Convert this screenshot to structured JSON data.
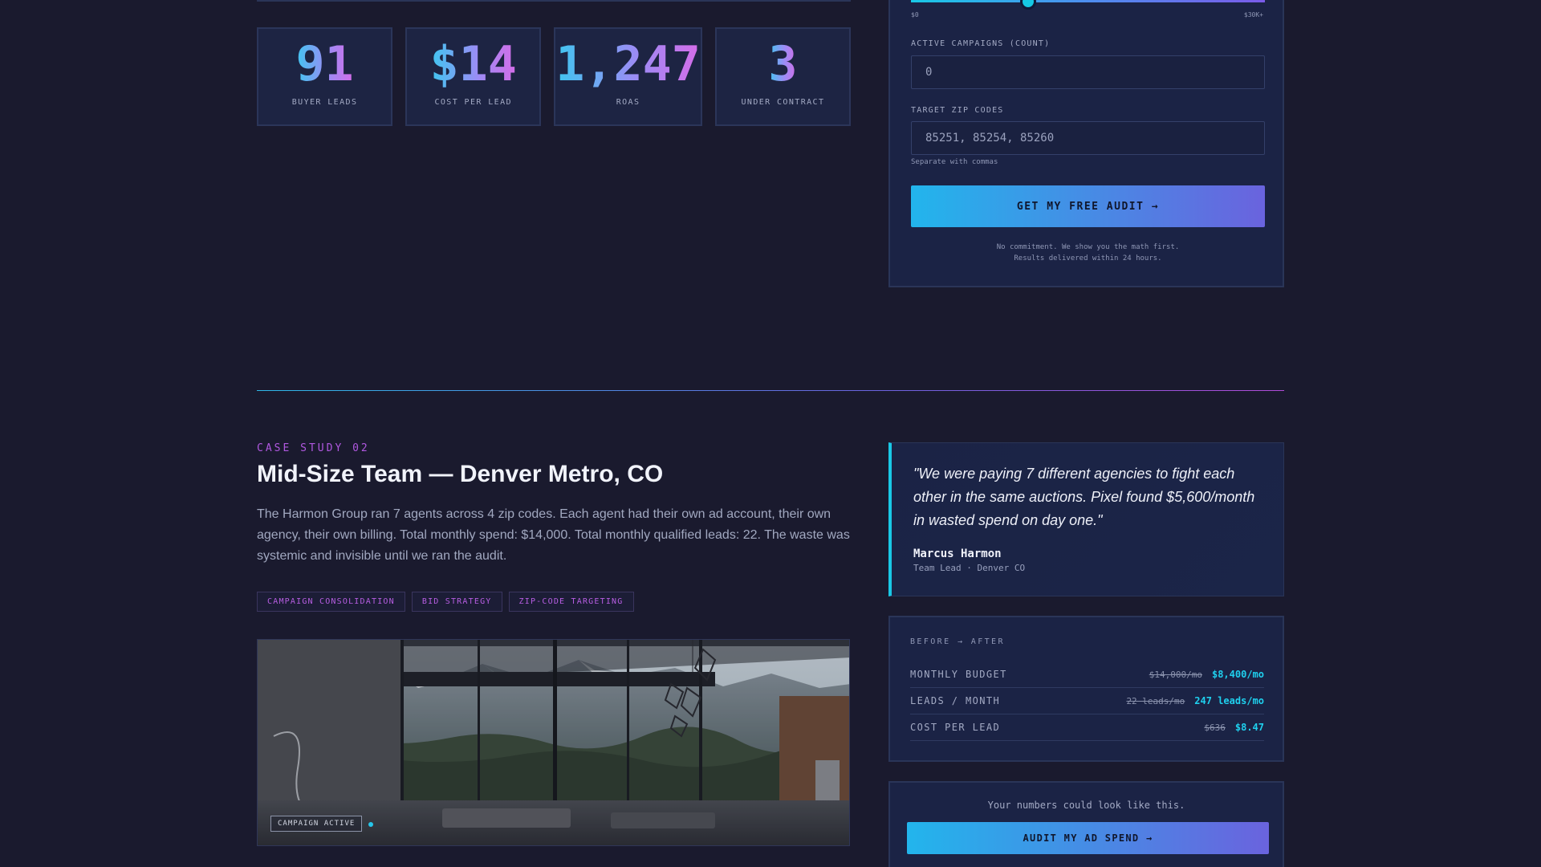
{
  "stats": [
    {
      "value": "91",
      "label": "BUYER LEADS"
    },
    {
      "value": "$14",
      "label": "COST PER LEAD"
    },
    {
      "value": "1,247",
      "label": "ROAS"
    },
    {
      "value": "3",
      "label": "UNDER CONTRACT"
    }
  ],
  "form": {
    "slider": {
      "min_label": "$0",
      "max_label": "$30K+",
      "value_fraction": 0.33
    },
    "campaigns_label": "ACTIVE CAMPAIGNS (COUNT)",
    "campaigns_placeholder": "0",
    "zip_label": "TARGET ZIP CODES",
    "zip_placeholder": "85251, 85254, 85260",
    "zip_hint": "Separate with commas",
    "submit_label": "GET MY FREE AUDIT →",
    "note_line1": "No commitment. We show you the math first.",
    "note_line2": "Results delivered within 24 hours."
  },
  "case_study": {
    "eyebrow": "CASE STUDY 02",
    "title": "Mid-Size Team — Denver Metro, CO",
    "body": "The Harmon Group ran 7 agents across 4 zip codes. Each agent had their own ad account, their own agency, their own billing. Total monthly spend: $14,000. Total monthly qualified leads: 22. The waste was systemic and invisible until we ran the audit.",
    "tags": [
      "CAMPAIGN CONSOLIDATION",
      "BID STRATEGY",
      "ZIP-CODE TARGETING"
    ],
    "image_badge": "CAMPAIGN ACTIVE"
  },
  "testimonial": {
    "quote": "\"We were paying 7 different agencies to fight each other in the same auctions. Pixel found $5,600/month in wasted spend on day one.\"",
    "name": "Marcus Harmon",
    "role": "Team Lead · Denver CO"
  },
  "before_after": {
    "heading": "BEFORE → AFTER",
    "rows": [
      {
        "label": "MONTHLY BUDGET",
        "before": "$14,000/mo",
        "after": "$8,400/mo"
      },
      {
        "label": "LEADS / MONTH",
        "before": "22 leads/mo",
        "after": "247 leads/mo"
      },
      {
        "label": "COST PER LEAD",
        "before": "$636",
        "after": "$8.47"
      }
    ]
  },
  "cta": {
    "text": "Your numbers could look like this.",
    "button": "AUDIT MY AD SPEND →"
  },
  "colors": {
    "background": "#1a1a2e",
    "card": "#1b2345",
    "accent_cyan": "#19c8e6",
    "accent_purple": "#b058e0"
  }
}
